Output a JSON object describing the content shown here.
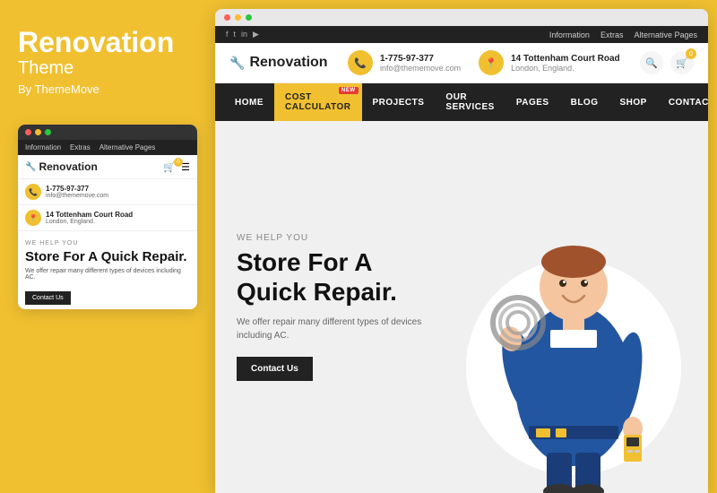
{
  "left": {
    "title": "Renovation",
    "subtitle": "Theme",
    "by": "By ThemeMove",
    "mobile": {
      "nav_items": [
        "Information",
        "Extras",
        "Alternative Pages"
      ],
      "logo": "Renovation",
      "phone": "1-775-97-377",
      "email": "info@thememove.com",
      "address_line1": "14 Tottenham Court Road",
      "address_line2": "London, England.",
      "we_help": "WE HELP YOU",
      "hero_title": "Store For A Quick Repair.",
      "hero_desc": "We offer repair many different types of devices including AC.",
      "cta_label": "Contact Us"
    }
  },
  "browser": {
    "social_icons": [
      "f",
      "t",
      "in",
      "yt"
    ],
    "nav_links": [
      "Information",
      "Extras",
      "Alternative Pages"
    ],
    "logo": "Renovation",
    "phone": "1-775-97-377",
    "email": "info@thememove.com",
    "address_line1": "14 Tottenham Court Road",
    "address_line2": "London, England.",
    "nav_items": [
      {
        "label": "HOME",
        "badge": ""
      },
      {
        "label": "COST CALCULATOR",
        "badge": "NEW"
      },
      {
        "label": "PROJECTS",
        "badge": ""
      },
      {
        "label": "OUR SERVICES",
        "badge": ""
      },
      {
        "label": "PAGES",
        "badge": ""
      },
      {
        "label": "BLOG",
        "badge": ""
      },
      {
        "label": "SHOP",
        "badge": ""
      },
      {
        "label": "CONTACT",
        "badge": ""
      }
    ],
    "hero": {
      "we_help": "WE HELP YOU",
      "title_line1": "Store For A",
      "title_line2": "Quick Repair.",
      "desc": "We offer repair many different types of devices including AC.",
      "cta_label": "Contact Us"
    }
  },
  "dots": {
    "red": "#ff5f57",
    "yellow": "#febc2e",
    "green": "#28c840"
  },
  "colors": {
    "accent": "#f0c030",
    "dark": "#222222",
    "badge_red": "#e53935"
  }
}
